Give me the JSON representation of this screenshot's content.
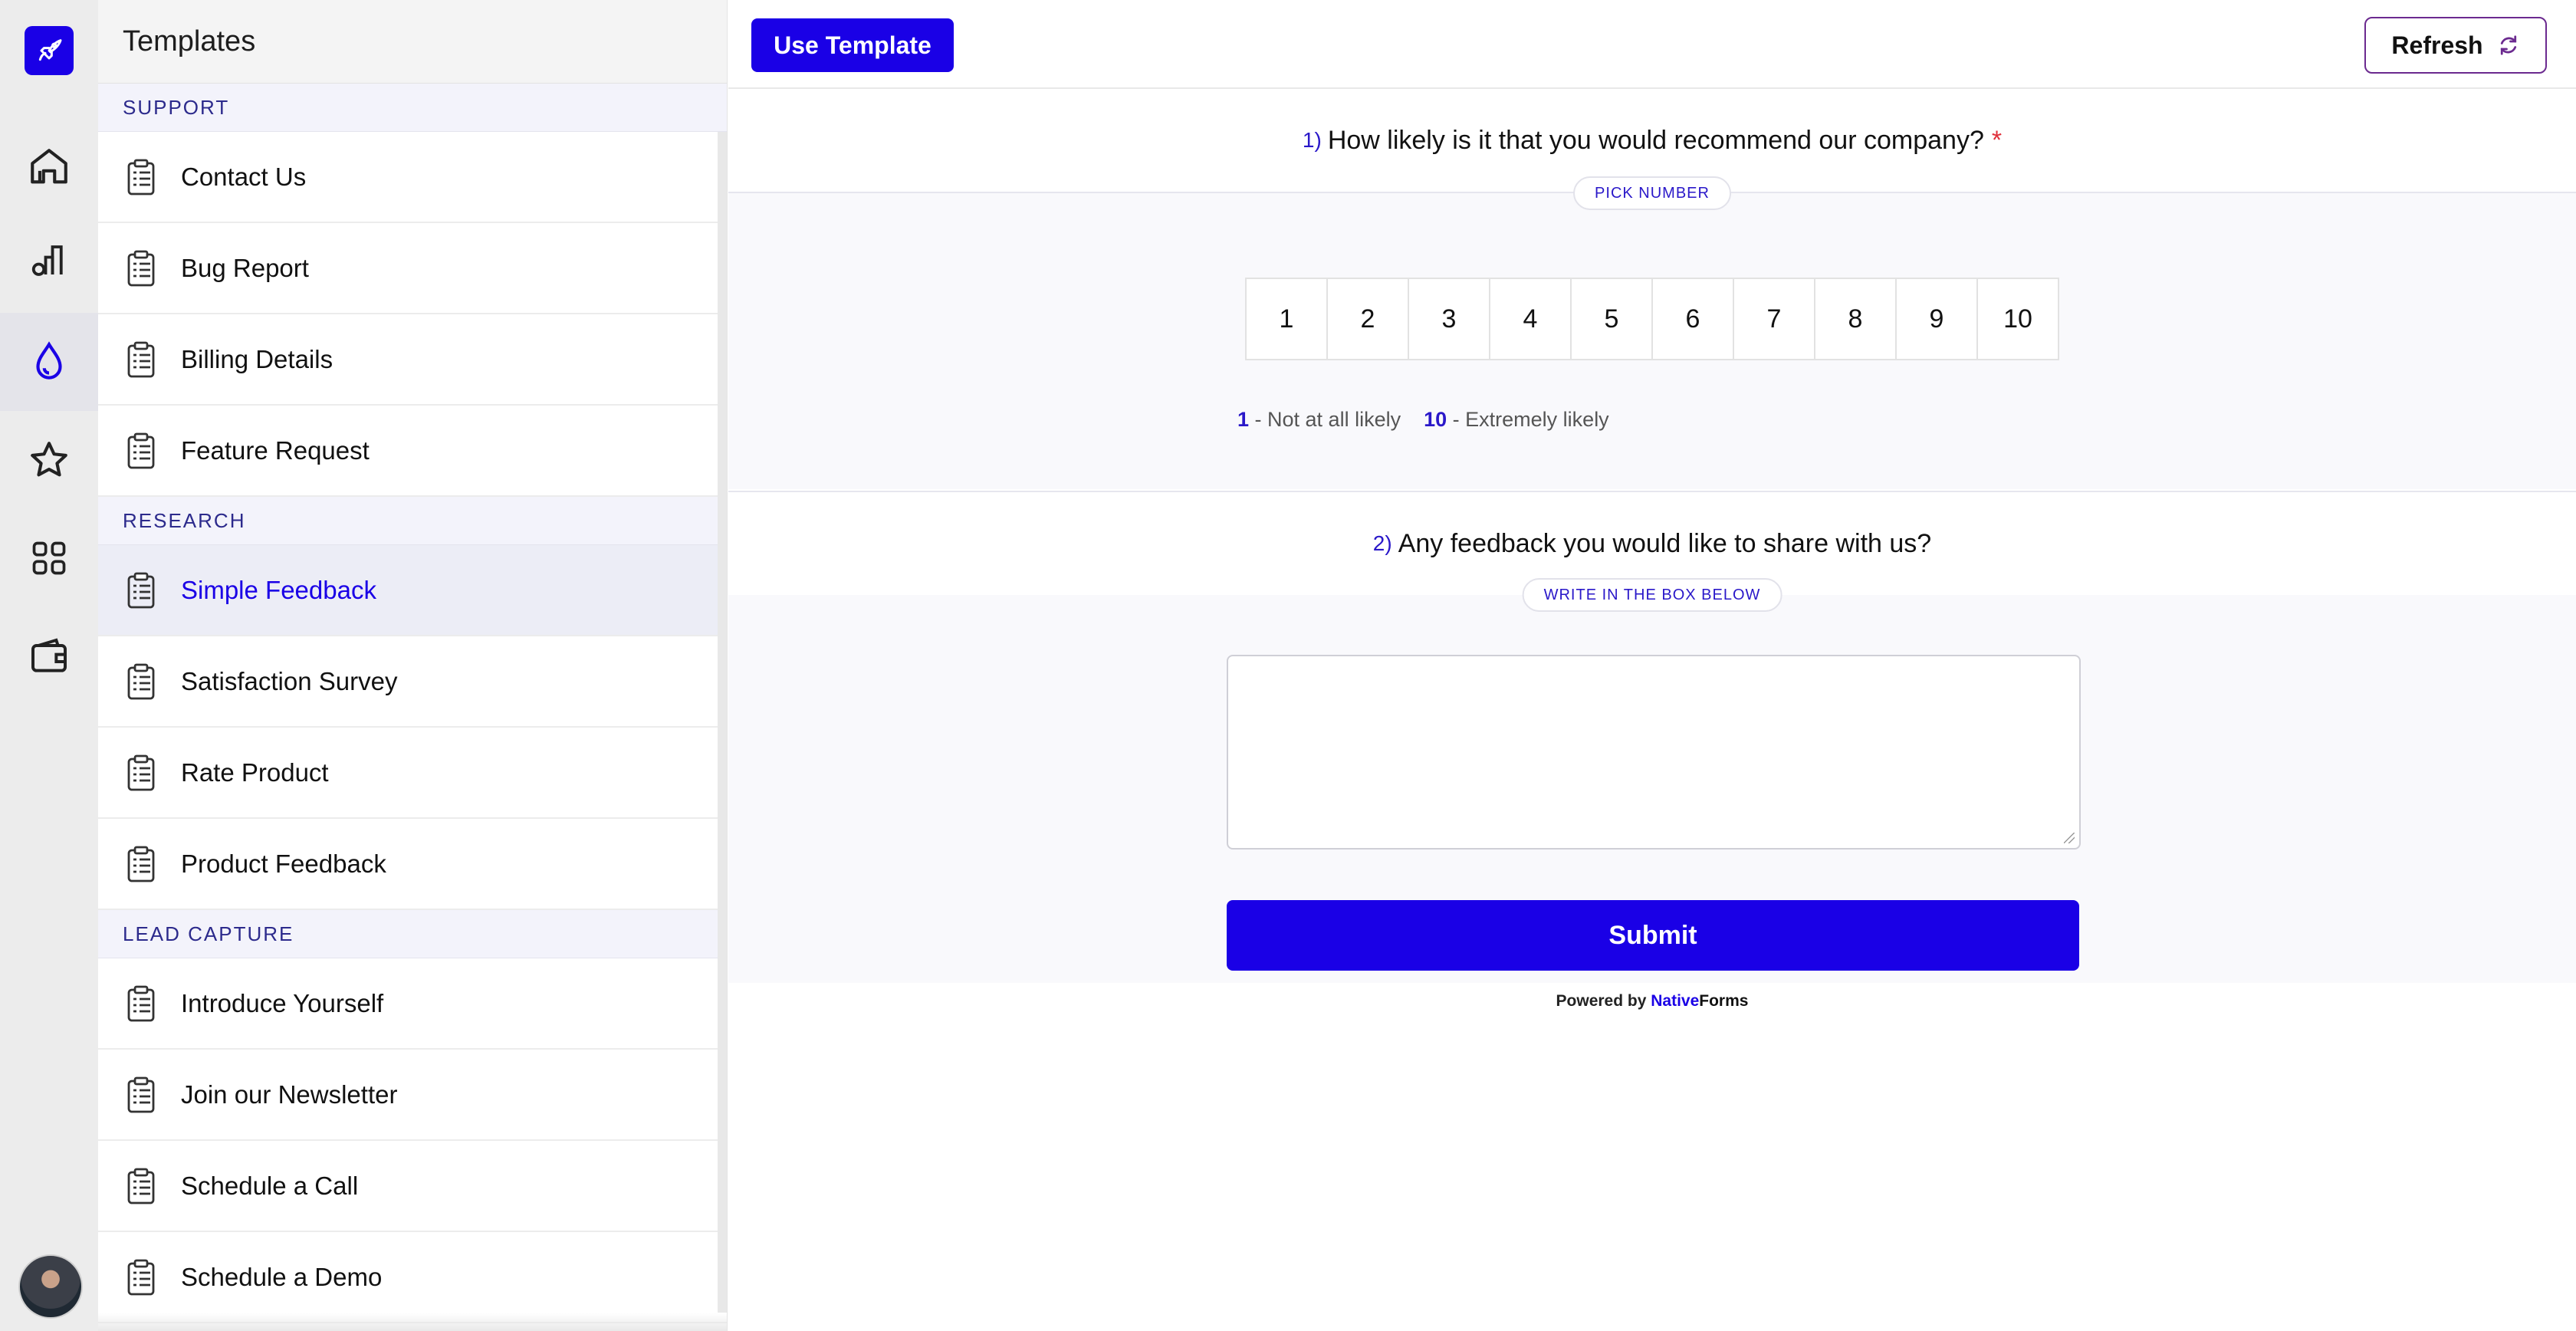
{
  "rail": {
    "items": [
      {
        "icon": "home-icon"
      },
      {
        "icon": "analytics-icon"
      },
      {
        "icon": "templates-drop-icon",
        "active": true
      },
      {
        "icon": "star-icon"
      },
      {
        "icon": "apps-grid-icon"
      },
      {
        "icon": "wallet-icon"
      }
    ],
    "logo_icon": "rocket-icon",
    "avatar": "user-avatar"
  },
  "panel": {
    "title": "Templates",
    "sections": [
      {
        "name": "SUPPORT",
        "items": [
          "Contact Us",
          "Bug Report",
          "Billing Details",
          "Feature Request"
        ]
      },
      {
        "name": "RESEARCH",
        "items": [
          "Simple Feedback",
          "Satisfaction Survey",
          "Rate Product",
          "Product Feedback"
        ]
      },
      {
        "name": "LEAD CAPTURE",
        "items": [
          "Introduce Yourself",
          "Join our Newsletter",
          "Schedule a Call",
          "Schedule a Demo"
        ]
      }
    ],
    "selected": "Simple Feedback"
  },
  "toolbar": {
    "use_template_label": "Use Template",
    "refresh_label": "Refresh"
  },
  "form": {
    "q1": {
      "number": "1)",
      "text": "How likely is it that you would recommend our company?",
      "required_mark": "*",
      "hint": "PICK NUMBER",
      "scale": [
        "1",
        "2",
        "3",
        "4",
        "5",
        "6",
        "7",
        "8",
        "9",
        "10"
      ],
      "low_value": "1",
      "low_label": " - Not at all likely",
      "high_value": "10",
      "high_label": " - Extremely likely"
    },
    "q2": {
      "number": "2)",
      "text": "Any feedback you would like to share with us?",
      "hint": "WRITE IN THE BOX BELOW",
      "value": ""
    },
    "submit_label": "Submit",
    "powered_prefix": "Powered by ",
    "brand_part1": "Native",
    "brand_part2": "Forms"
  },
  "colors": {
    "accent": "#1a00e6",
    "required": "#e0303b",
    "refresh_border": "#6b2a8f"
  }
}
